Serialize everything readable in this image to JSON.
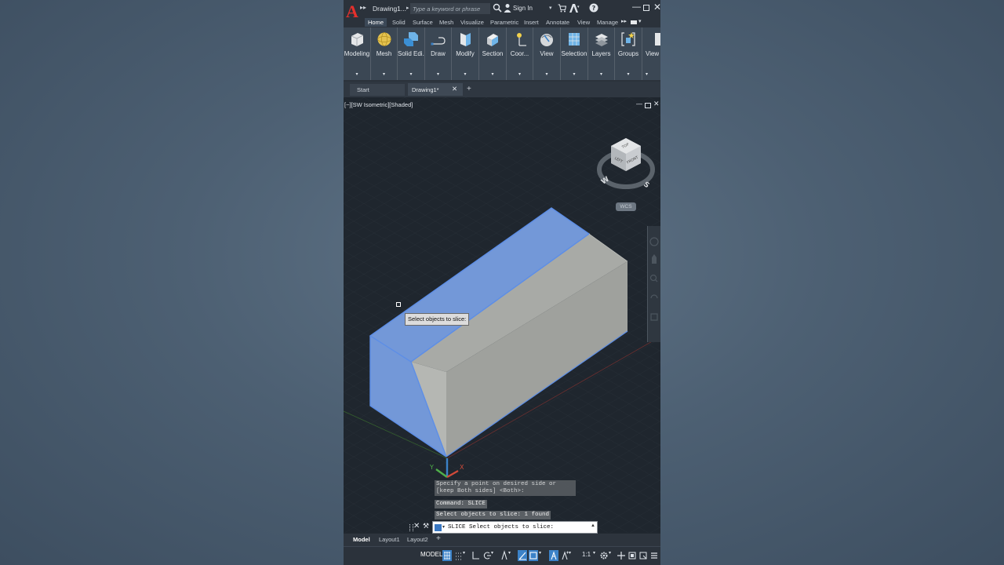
{
  "app": {
    "logo": "A",
    "document_title": "Drawing1...",
    "search_placeholder": "Type a keyword or phrase",
    "signin_label": "Sign In"
  },
  "ribbon": {
    "tabs": [
      "Home",
      "Solid",
      "Surface",
      "Mesh",
      "Visualize",
      "Parametric",
      "Insert",
      "Annotate",
      "View",
      "Manage"
    ],
    "active_tab": "Home",
    "buttons": [
      {
        "label": "Modeling",
        "icon": "box-icon"
      },
      {
        "label": "Mesh",
        "icon": "sphere-icon"
      },
      {
        "label": "Solid Edi...",
        "icon": "solid-edit-icon"
      },
      {
        "label": "Draw",
        "icon": "draw-icon"
      },
      {
        "label": "Modify",
        "icon": "modify-icon"
      },
      {
        "label": "Section",
        "icon": "section-icon"
      },
      {
        "label": "Coor...",
        "icon": "coordinates-icon"
      },
      {
        "label": "View",
        "icon": "view-icon"
      },
      {
        "label": "Selection",
        "icon": "selection-icon"
      },
      {
        "label": "Layers",
        "icon": "layers-icon"
      },
      {
        "label": "Groups",
        "icon": "groups-icon"
      },
      {
        "label": "View",
        "icon": "view-panel-icon"
      }
    ]
  },
  "file_tabs": {
    "start": "Start",
    "drawing": "Drawing1*"
  },
  "viewport": {
    "label": "[−][SW Isometric][Shaded]",
    "viewcube": {
      "top": "TOP",
      "left": "LEFT",
      "front": "FRONT",
      "compass_w": "W",
      "compass_s": "S"
    },
    "wcs": "WCS",
    "tooltip": "Select objects to slice:",
    "ucs_y": "Y",
    "ucs_x": "X"
  },
  "command_history": [
    "Specify a point on desired side or [keep Both sides] <Both>:",
    "Command: SLICE",
    "Select objects to slice: 1 found"
  ],
  "command_line": {
    "text": "SLICE Select objects to slice:"
  },
  "layout_tabs": [
    "Model",
    "Layout1",
    "Layout2"
  ],
  "status_bar": {
    "model": "MODEL",
    "scale": "1:1"
  },
  "colors": {
    "accent_blue": "#3b82c8",
    "selection_blue": "#6f94d6",
    "solid_gray": "#a9aba6",
    "logo_red": "#e5302c"
  }
}
